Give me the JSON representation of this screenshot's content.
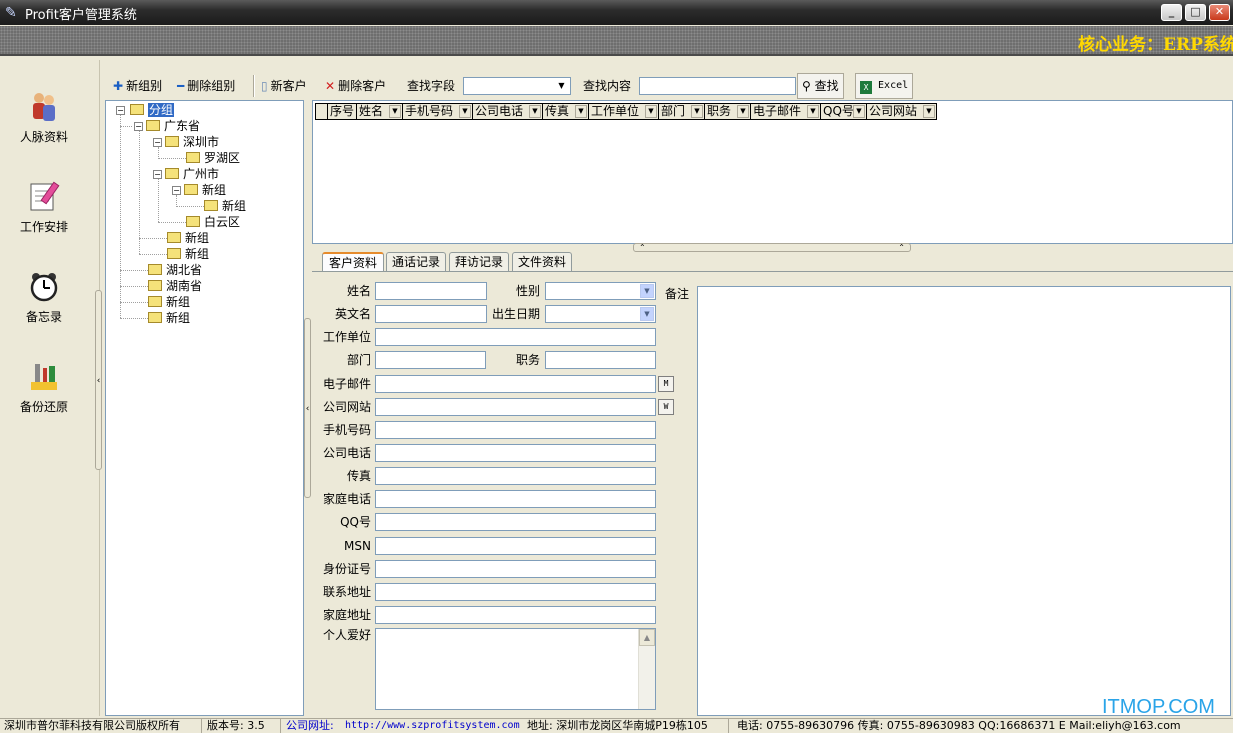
{
  "window": {
    "title": "Profit客户管理系统",
    "buttons": [
      "minimize",
      "maximize",
      "close"
    ]
  },
  "banner": {
    "marquee": "核心业务：ERP系统"
  },
  "nav": [
    {
      "label": "人脉资料",
      "icon": "people-icon"
    },
    {
      "label": "工作安排",
      "icon": "schedule-icon"
    },
    {
      "label": "备忘录",
      "icon": "alarm-clock-icon"
    },
    {
      "label": "备份还原",
      "icon": "tools-icon"
    }
  ],
  "toolbar": {
    "new_group": "新组别",
    "delete_group": "删除组别",
    "new_customer": "新客户",
    "delete_customer": "删除客户",
    "search_field_label": "查找字段",
    "search_field_value": "",
    "search_content_label": "查找内容",
    "search_content_value": "",
    "search_button": "查找",
    "excel_button": "Excel"
  },
  "tree": {
    "root": "分组",
    "nodes": {
      "guangdong": "广东省",
      "shenzhen": "深圳市",
      "luohu": "罗湖区",
      "guangzhou": "广州市",
      "gz_new": "新组",
      "gz_new_child": "新组",
      "baiyun": "白云区",
      "gd_new1": "新组",
      "gd_new2": "新组",
      "hubei": "湖北省",
      "hunan": "湖南省",
      "root_new1": "新组",
      "root_new2": "新组"
    }
  },
  "grid": {
    "columns": [
      "序号",
      "姓名",
      "手机号码",
      "公司电话",
      "传真",
      "工作单位",
      "部门",
      "职务",
      "电子邮件",
      "QQ号",
      "公司网站"
    ],
    "rows": []
  },
  "tabs": [
    "客户资料",
    "通话记录",
    "拜访记录",
    "文件资料"
  ],
  "form": {
    "name": "姓名",
    "gender": "性别",
    "english_name": "英文名",
    "birthday": "出生日期",
    "company": "工作单位",
    "department": "部门",
    "position": "职务",
    "email": "电子邮件",
    "website": "公司网站",
    "mobile": "手机号码",
    "company_phone": "公司电话",
    "fax": "传真",
    "home_phone": "家庭电话",
    "qq": "QQ号",
    "msn": "MSN",
    "id_number": "身份证号",
    "contact_address": "联系地址",
    "home_address": "家庭地址",
    "hobbies": "个人爱好",
    "remark": "备注",
    "email_btn": "M",
    "web_btn": "W"
  },
  "watermark": "ITMOP.COM",
  "status": {
    "copyright": "深圳市普尔菲科技有限公司版权所有",
    "version": "版本号: 3.5",
    "website_label": "公司网址: ",
    "website_url": "http://www.szprofitsystem.com",
    "address": "地址: 深圳市龙岗区华南城P19栋105",
    "contact": "电话: 0755-89630796 传真: 0755-89630983 QQ:16686371 E Mail:eliyh@163.com"
  }
}
